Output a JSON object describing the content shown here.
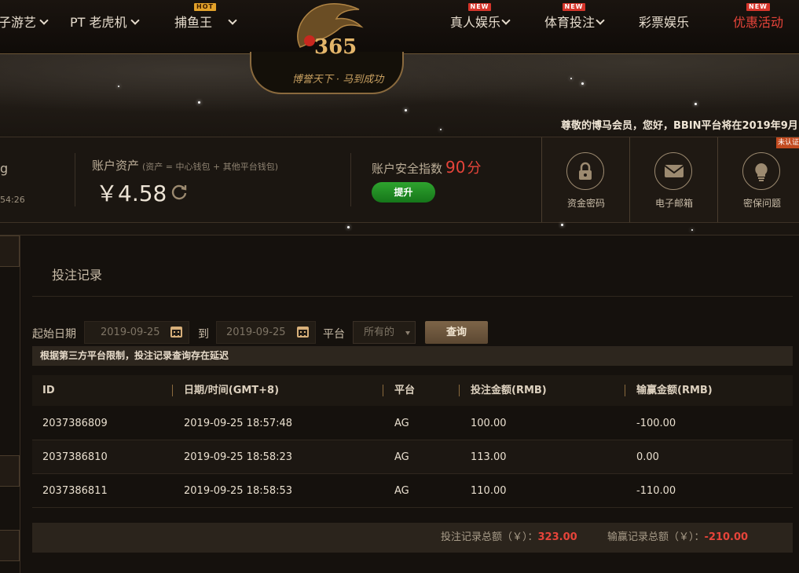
{
  "nav": {
    "items": [
      {
        "label": "子游艺",
        "tag": ""
      },
      {
        "label": "PT 老虎机",
        "tag": ""
      },
      {
        "label": "捕鱼王",
        "tag": "HOT"
      },
      {
        "label": "真人娱乐",
        "tag": "NEW"
      },
      {
        "label": "体育投注",
        "tag": "NEW"
      },
      {
        "label": "彩票娱乐",
        "tag": ""
      },
      {
        "label": "优惠活动",
        "tag": "NEW"
      }
    ]
  },
  "logo": {
    "text": "365",
    "slogan": "博誉天下 · 马到成功"
  },
  "banner": {
    "announcement": "尊敬的博马会员，您好，BBIN平台将在2019年9月"
  },
  "account": {
    "left_partial_1": "g",
    "left_partial_2": "54:26",
    "assets_title": "账户资产",
    "assets_note": "(资产 = 中心钱包 + 其他平台钱包)",
    "assets_amount": "￥4.58",
    "security_title": "账户安全指数",
    "security_score": "90",
    "security_unit": "分",
    "upgrade_label": "提升",
    "security_items": [
      {
        "label": "资金密码",
        "icon": "lock-icon"
      },
      {
        "label": "电子邮箱",
        "icon": "mail-icon"
      },
      {
        "label": "密保问题",
        "icon": "bulb-icon"
      }
    ],
    "unverified_badge": "未认证"
  },
  "main": {
    "title": "投注记录",
    "filter": {
      "start_label": "起始日期",
      "start_value": "2019-09-25",
      "to_label": "到",
      "end_value": "2019-09-25",
      "platform_label": "平台",
      "platform_value": "所有的",
      "query_label": "查询"
    },
    "notice": "根据第三方平台限制，投注记录查询存在延迟",
    "table": {
      "headers": [
        "ID",
        "日期/时间(GMT+8)",
        "平台",
        "投注金额(RMB)",
        "输赢金额(RMB)"
      ],
      "rows": [
        [
          "2037386809",
          "2019-09-25 18:57:48",
          "AG",
          "100.00",
          "-100.00"
        ],
        [
          "2037386810",
          "2019-09-25 18:58:23",
          "AG",
          "113.00",
          "0.00"
        ],
        [
          "2037386811",
          "2019-09-25 18:58:53",
          "AG",
          "110.00",
          "-110.00"
        ]
      ]
    },
    "summary": {
      "bet_label": "投注记录总额（￥）：",
      "bet_value": "323.00",
      "win_label": "输赢记录总额（￥）：",
      "win_value": "-210.00"
    }
  },
  "colors": {
    "accent_red": "#e6443a",
    "gold": "#c8a061",
    "green_button": "#1f8a22"
  }
}
